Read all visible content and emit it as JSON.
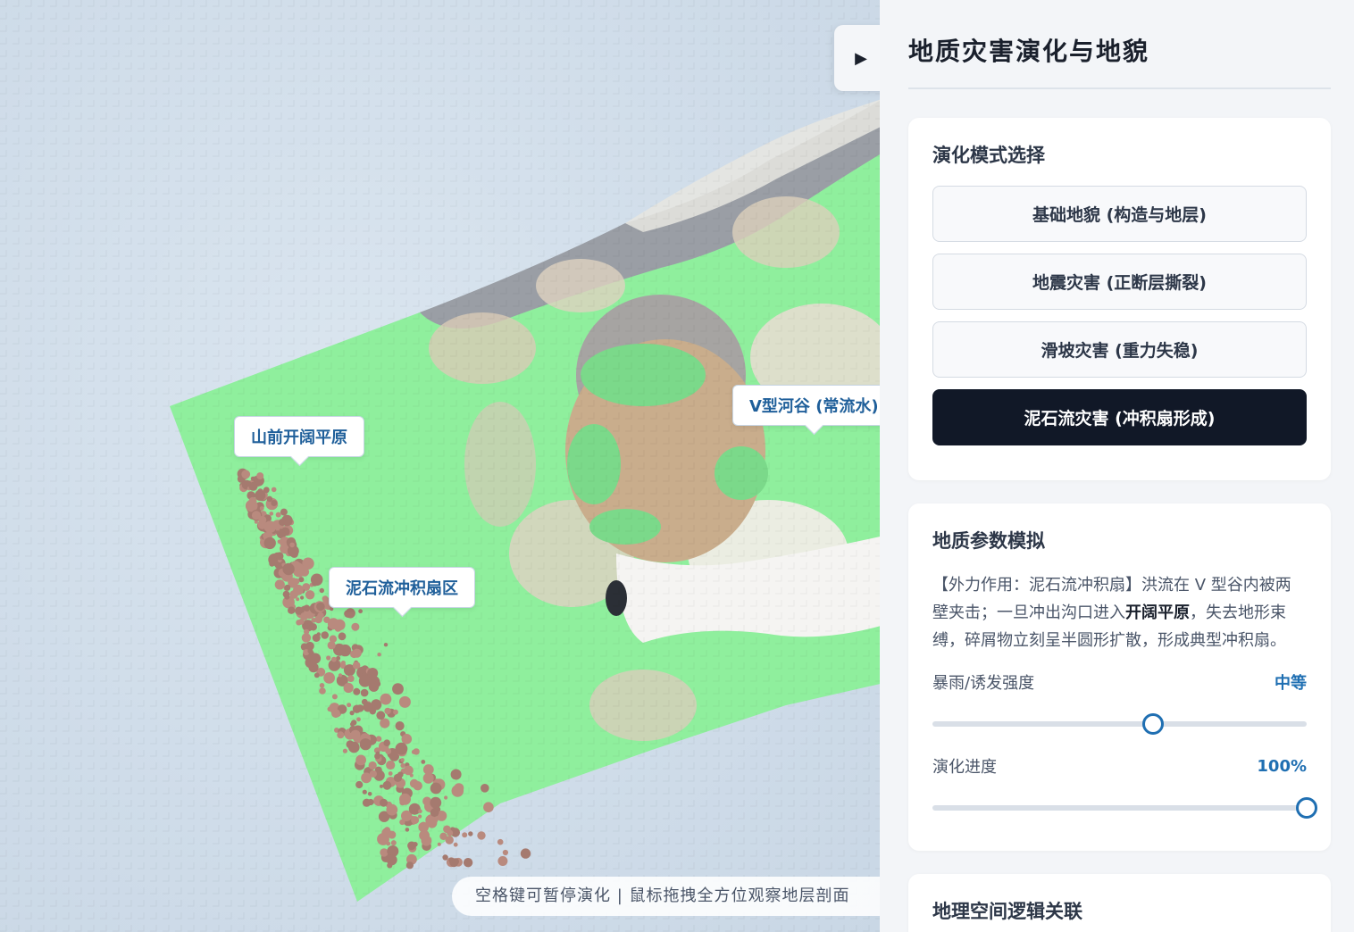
{
  "scene": {
    "labels": {
      "plain": "山前开阔平原",
      "valley": "V型河谷 (常流水)",
      "fan": "泥石流冲积扇区"
    },
    "hint": "空格键可暂停演化 | 鼠标拖拽全方位观察地层剖面",
    "toggle_icon": "▶"
  },
  "panel": {
    "title": "地质灾害演化与地貌",
    "mode_card": {
      "title": "演化模式选择",
      "modes": [
        "基础地貌 (构造与地层)",
        "地震灾害 (正断层撕裂)",
        "滑坡灾害 (重力失稳)",
        "泥石流灾害 (冲积扇形成)"
      ],
      "active_index": 3
    },
    "param_card": {
      "title": "地质参数模拟",
      "desc_part1": "【外力作用：泥石流冲积扇】洪流在 V 型谷内被两壁夹击；一旦冲出沟口进入",
      "desc_bold": "开阔平原",
      "desc_part2": "，失去地形束缚，碎屑物立刻呈半圆形扩散，形成典型冲积扇。",
      "rain_label": "暴雨/诱发强度",
      "rain_value": "中等",
      "rain_fraction": 0.59,
      "progress_label": "演化进度",
      "progress_value": "100%",
      "progress_fraction": 1.0
    },
    "logic_card": {
      "title": "地理空间逻辑关联"
    }
  },
  "colors": {
    "accent": "#1f6fb2",
    "active_button": "#111827",
    "grass": "#8fe89a",
    "rock": "#d8c8b0",
    "debris": "#b98a7e"
  }
}
